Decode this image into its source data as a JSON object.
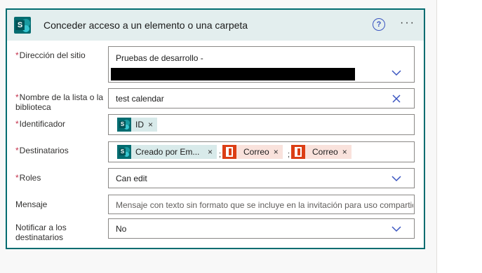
{
  "card": {
    "title": "Conceder acceso a un elemento o una carpeta",
    "help_icon": "help-circle-icon",
    "more_icon": "more-ellipsis-icon",
    "more_text": "···"
  },
  "fields": {
    "site_address": {
      "required": "*",
      "label": "Dirección del sitio",
      "value": "Pruebas de desarrollo -"
    },
    "list_name": {
      "required": "*",
      "label": "Nombre de la lista o la biblioteca",
      "value": "test calendar"
    },
    "identifier": {
      "required": "*",
      "label": "Identificador",
      "token": "ID",
      "remove": "×"
    },
    "recipients": {
      "required": "*",
      "label": "Destinatarios",
      "tokens": [
        {
          "label": "Creado por Em...",
          "remove": "×",
          "icon": "sharepoint-icon"
        },
        {
          "label": "Correo",
          "remove": "×",
          "icon": "office-icon"
        },
        {
          "label": "Correo",
          "remove": "×",
          "icon": "office-icon"
        }
      ],
      "separator": ";"
    },
    "roles": {
      "required": "*",
      "label": "Roles",
      "value": "Can edit"
    },
    "message": {
      "label": "Mensaje",
      "placeholder": "Mensaje con texto sin formato que se incluye en la invitación para uso compartido"
    },
    "notify": {
      "label": "Notificar a los destinatarios",
      "value": "No"
    }
  },
  "colors": {
    "accent": "#036c70",
    "header_bg": "#e3eeee",
    "required": "#c4314b",
    "office": "#dc3e15"
  }
}
